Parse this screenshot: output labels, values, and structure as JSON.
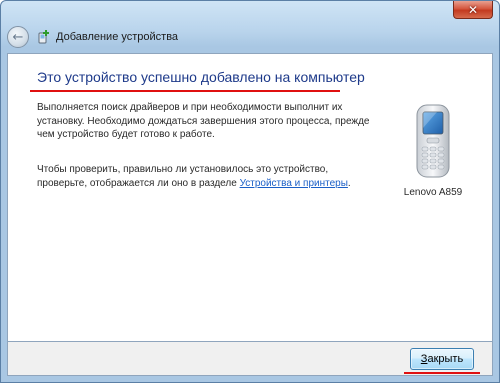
{
  "titlebar": {
    "close_symbol": "✕"
  },
  "navbar": {
    "back_icon": "back-arrow-icon",
    "title": "Добавление устройства"
  },
  "main": {
    "heading": "Это устройство успешно добавлено на компьютер",
    "paragraph1": "Выполняется поиск драйверов и при необходимости выполнит их установку. Необходимо дождаться завершения этого процесса, прежде чем устройство будет готово к работе.",
    "paragraph2_text": "Чтобы проверить, правильно ли установилось это устройство, проверьте, отображается ли оно в разделе ",
    "paragraph2_link": "Устройства и принтеры",
    "paragraph2_end": ".",
    "device_name": "Lenovo A859"
  },
  "footer": {
    "close_button_accel": "З",
    "close_button_rest": "акрыть"
  },
  "colors": {
    "heading": "#1e3a8a",
    "highlight": "#e01010",
    "link": "#1a5fc7"
  }
}
